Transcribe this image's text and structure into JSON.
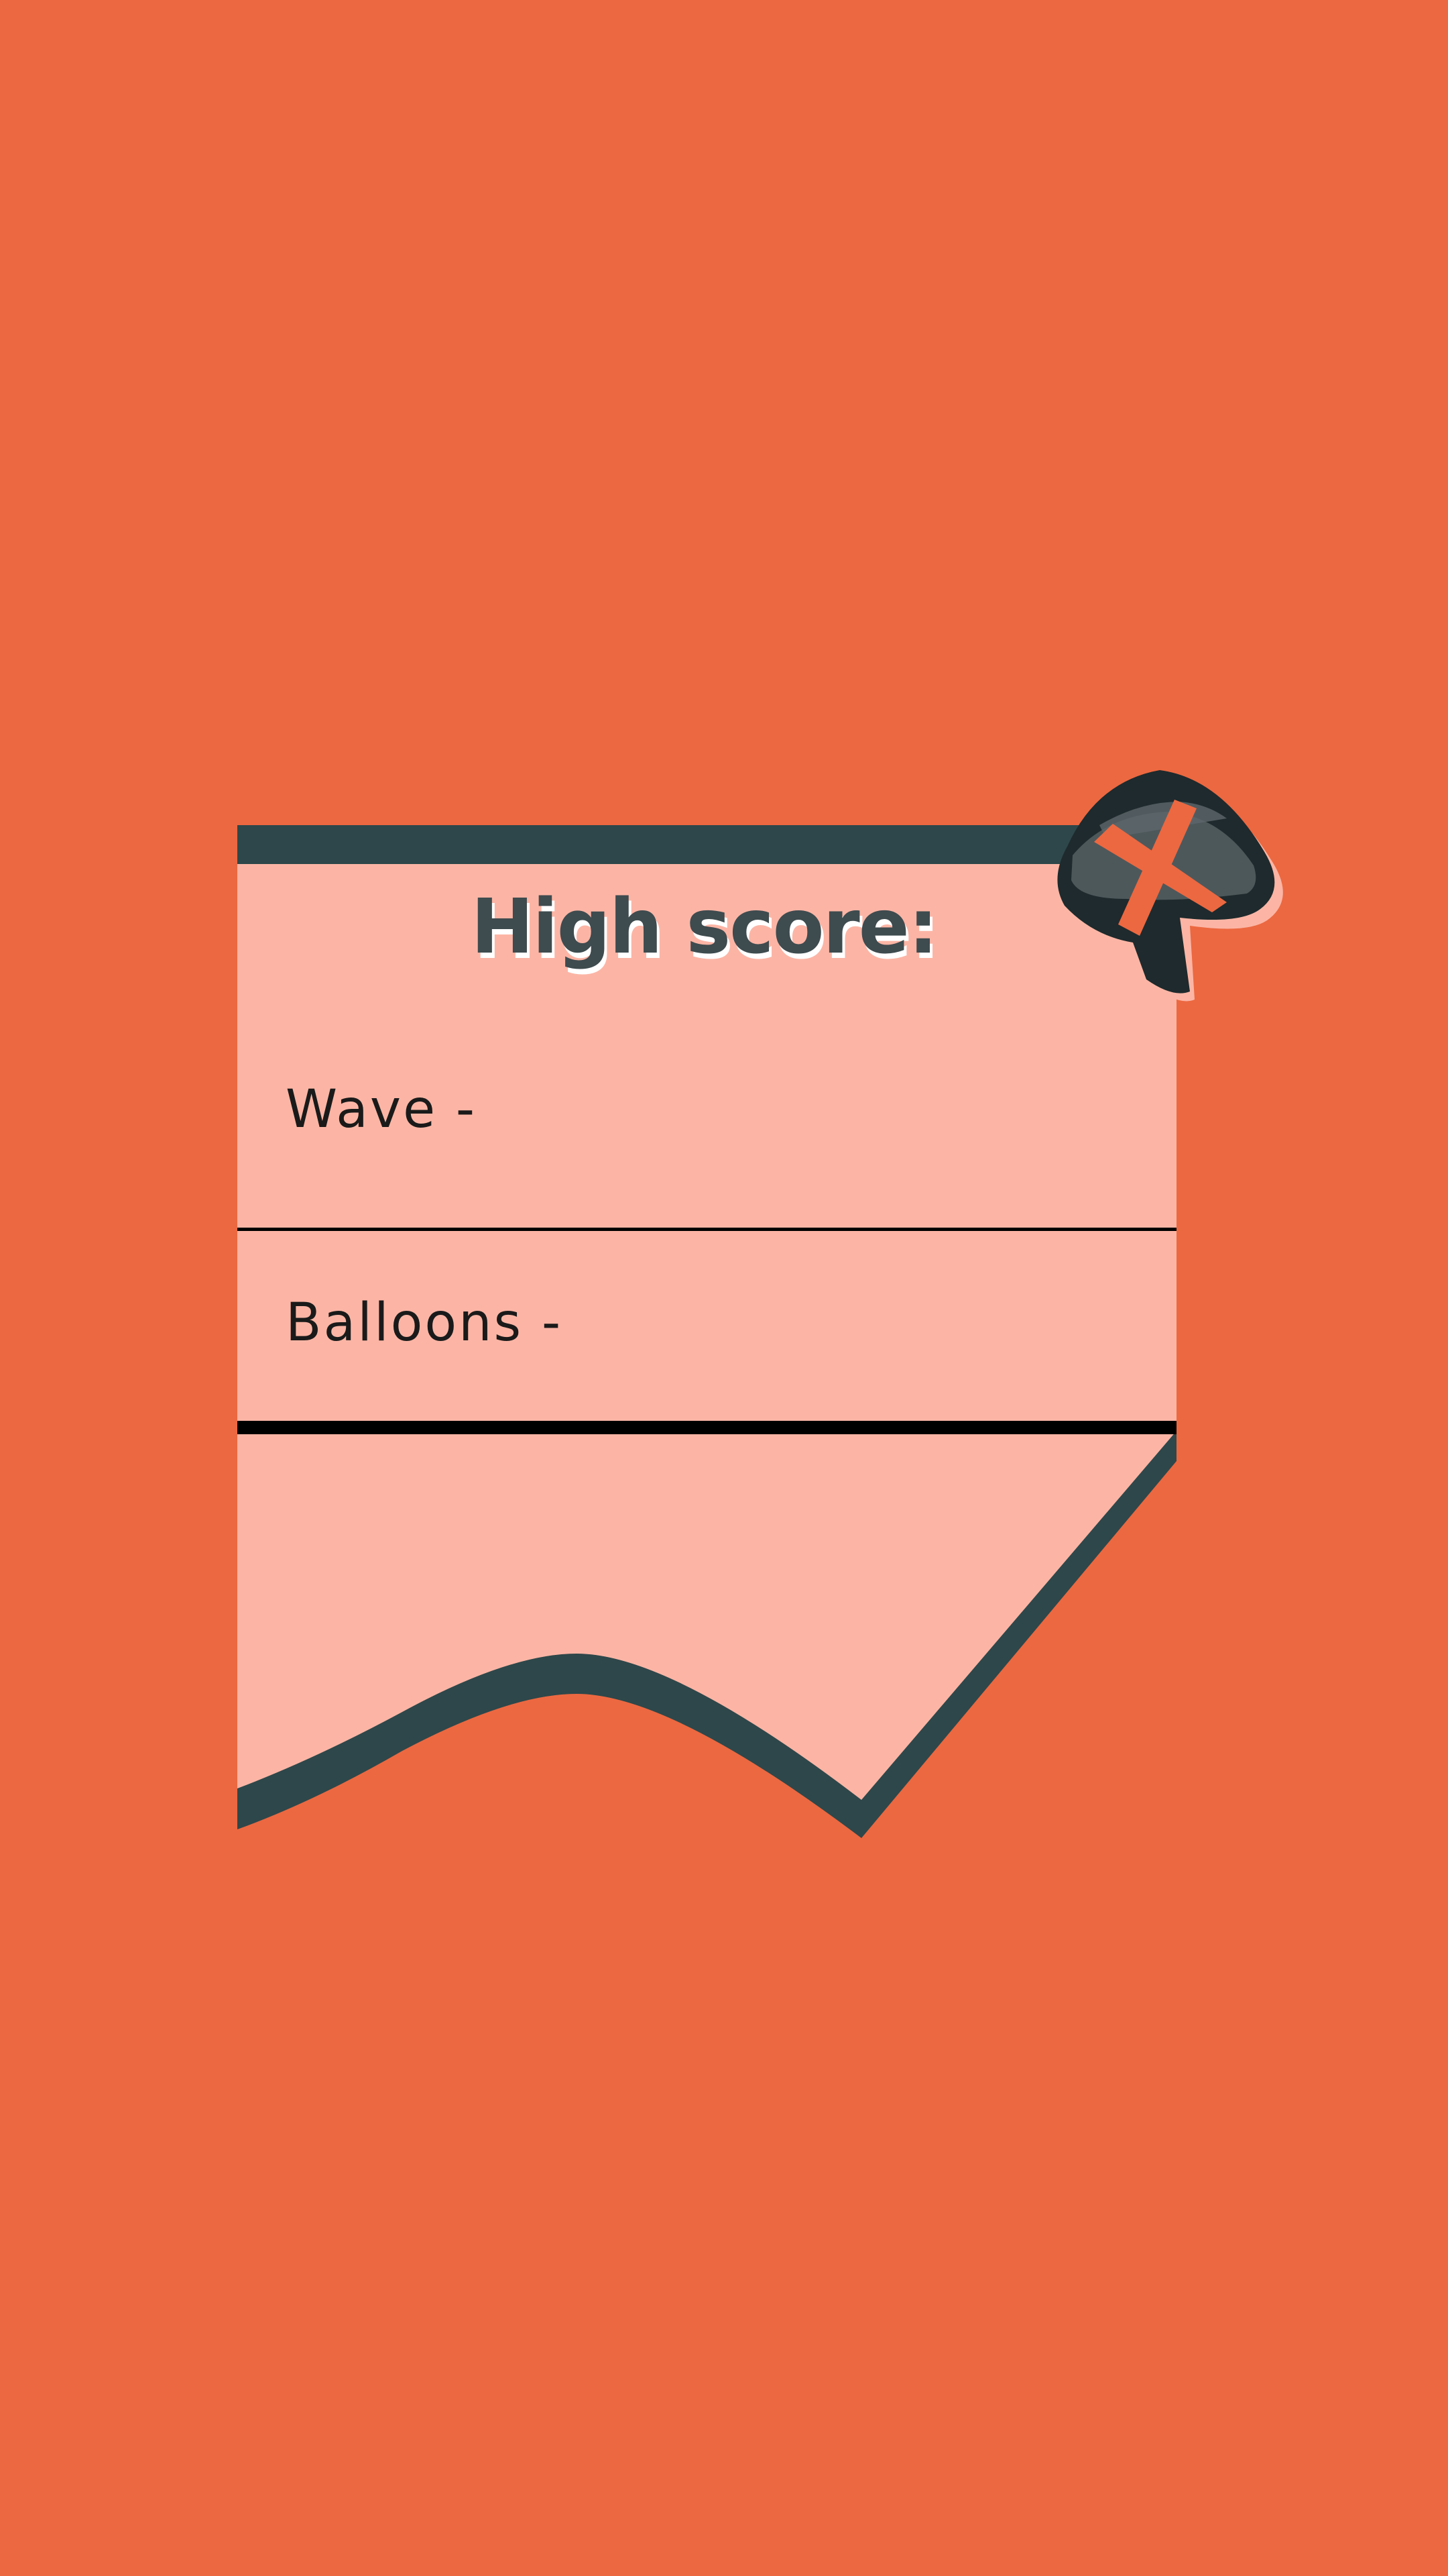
{
  "colors": {
    "background": "#ec6840",
    "card_fill": "#fcb5a5",
    "card_border": "#2e474a",
    "title_fill": "#3e4b4f",
    "title_shadow": "#ffffff",
    "row_text": "#1a1a1a",
    "divider": "#000000",
    "close_button_dark": "#1e2a2d",
    "close_button_mid": "#4d585b",
    "close_button_x": "#ec6840"
  },
  "panel": {
    "title": "High score:",
    "rows": [
      {
        "label": "Wave -"
      },
      {
        "label": "Balloons -"
      }
    ]
  },
  "close_button": {
    "icon": "close-x-balloon-icon"
  }
}
